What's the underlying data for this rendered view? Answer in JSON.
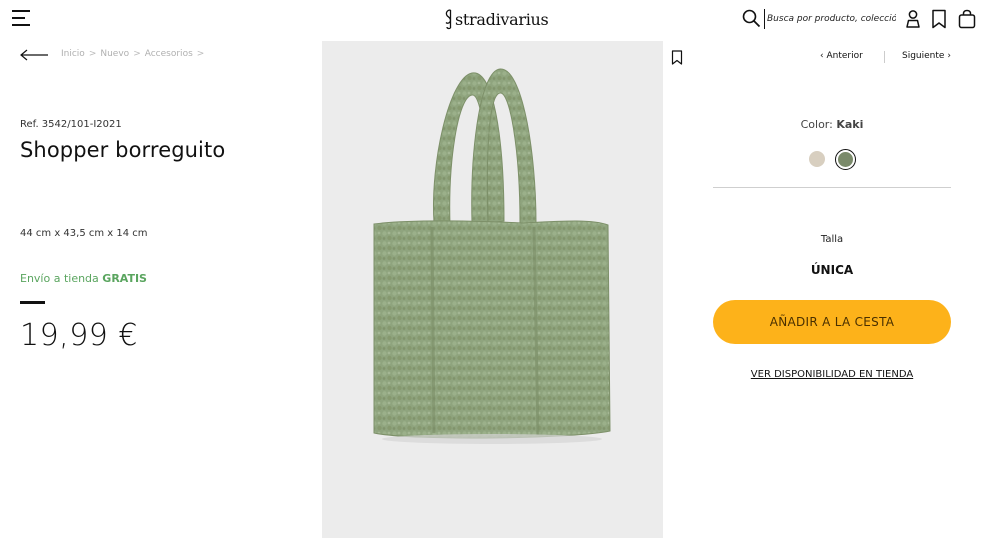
{
  "header": {
    "logo_text": "stradivarius",
    "search_placeholder": "Busca por producto, colección...",
    "icons": [
      "menu-icon",
      "search-icon",
      "user-icon",
      "wishlist-icon",
      "bag-icon"
    ]
  },
  "breadcrumb": {
    "items": [
      "Inicio",
      "Nuevo",
      "Accesorios"
    ],
    "separator": ">"
  },
  "product": {
    "ref": "Ref. 3542/101-I2021",
    "name": "Shopper borreguito",
    "dimensions": "44 cm x 43,5 cm x 14 cm",
    "shipping_prefix": "Envío a tienda",
    "shipping_free": "GRATIS",
    "price": "19,99 €"
  },
  "navigation": {
    "prev_label": "Anterior",
    "next_label": "Siguiente"
  },
  "options": {
    "color_label": "Color:",
    "color_value": "Kaki",
    "swatches": [
      {
        "name": "beige",
        "color": "#d8cfc0"
      },
      {
        "name": "kaki",
        "color": "#7a8a6a",
        "selected": true
      }
    ],
    "size_label": "Talla",
    "size_value": "ÚNICA"
  },
  "actions": {
    "add_to_cart": "AÑADIR A LA CESTA",
    "store_availability": "VER DISPONIBILIDAD EN TIENDA"
  },
  "colors": {
    "accent": "#fdb21a",
    "shipping_green": "#5aa55f",
    "bag_green": "#8fa47e"
  }
}
